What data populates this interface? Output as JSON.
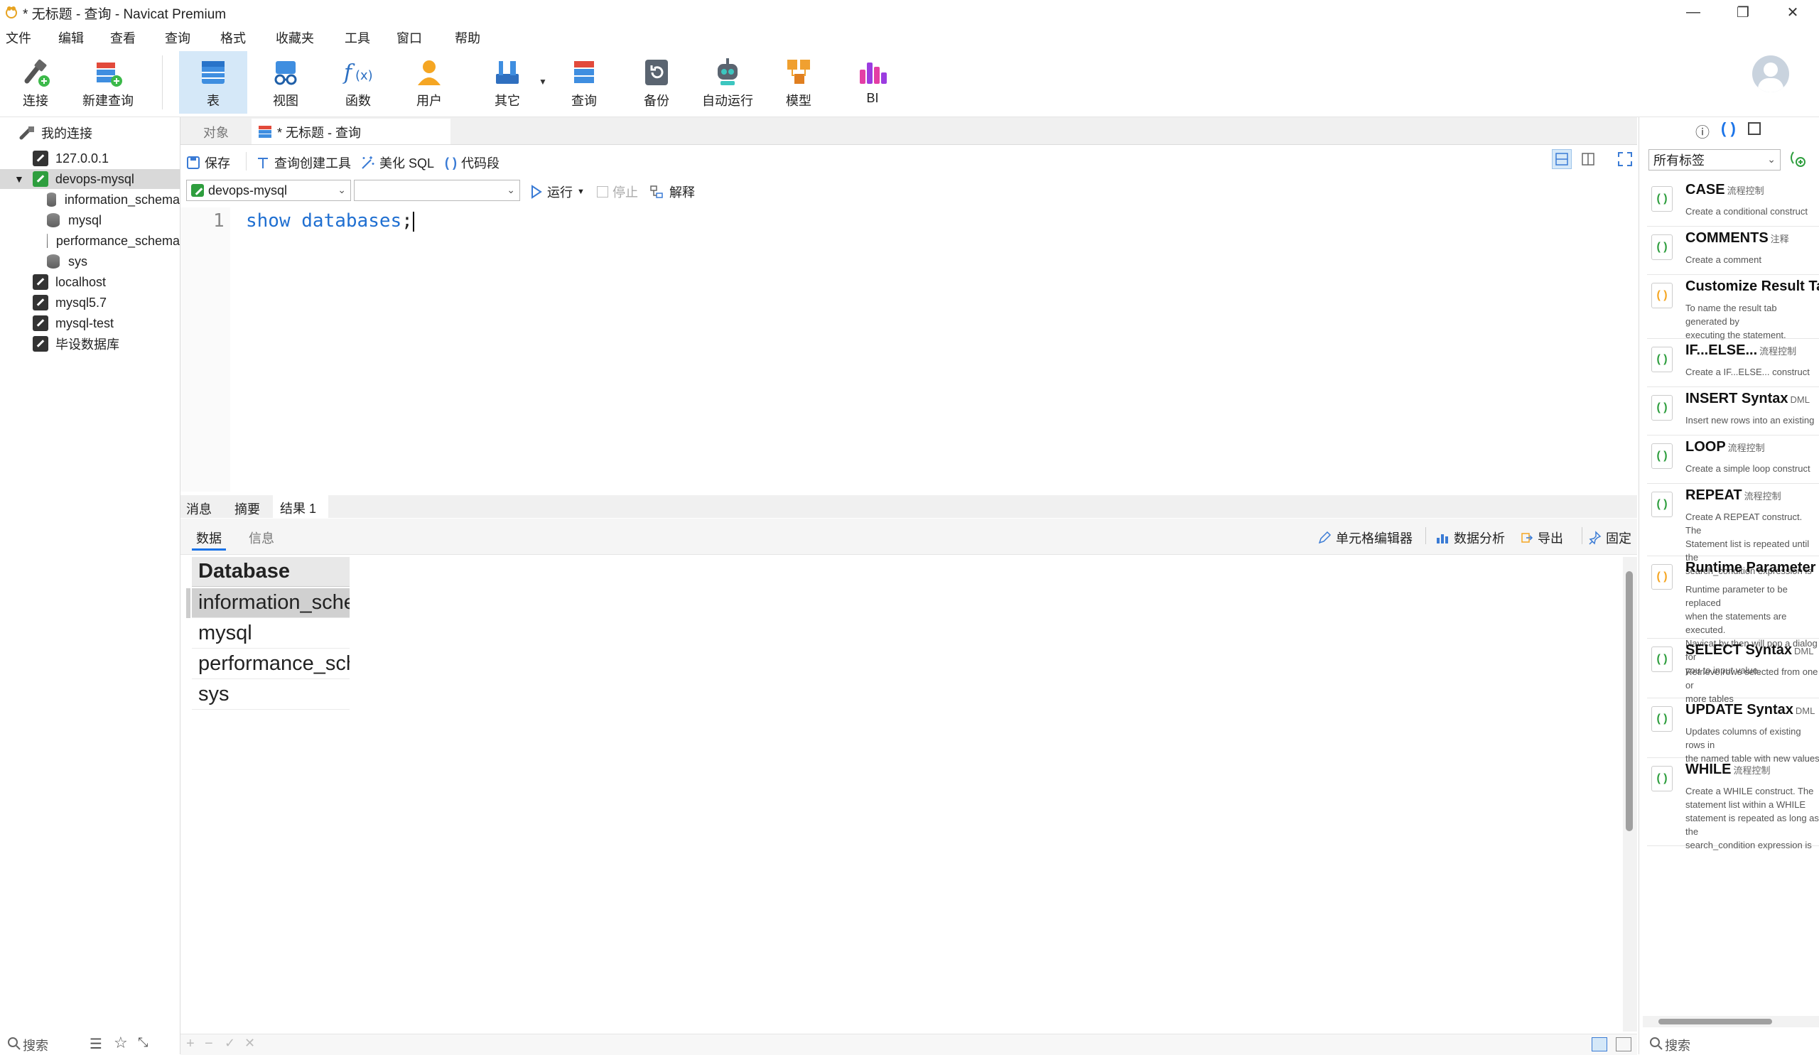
{
  "window": {
    "title": "* 无标题 - 查询 - Navicat Premium"
  },
  "menu": [
    "文件",
    "编辑",
    "查看",
    "查询",
    "格式",
    "收藏夹",
    "工具",
    "窗口",
    "帮助"
  ],
  "toolbar": {
    "items": [
      {
        "label": "连接"
      },
      {
        "label": "新建查询"
      },
      {
        "label": "表"
      },
      {
        "label": "视图"
      },
      {
        "label": "函数"
      },
      {
        "label": "用户"
      },
      {
        "label": "其它"
      },
      {
        "label": "查询"
      },
      {
        "label": "备份"
      },
      {
        "label": "自动运行"
      },
      {
        "label": "模型"
      },
      {
        "label": "BI"
      }
    ]
  },
  "tree": {
    "root": "我的连接",
    "items": [
      {
        "label": "127.0.0.1"
      },
      {
        "label": "devops-mysql"
      },
      {
        "label": "information_schema"
      },
      {
        "label": "mysql"
      },
      {
        "label": "performance_schema"
      },
      {
        "label": "sys"
      },
      {
        "label": "localhost"
      },
      {
        "label": "mysql5.7"
      },
      {
        "label": "mysql-test"
      },
      {
        "label": "毕设数据库"
      }
    ],
    "search_placeholder": "搜索"
  },
  "tabs": {
    "objects": "对象",
    "query": "* 无标题 - 查询"
  },
  "editor_toolbar": {
    "save": "保存",
    "builder": "查询创建工具",
    "beautify": "美化 SQL",
    "snippet": "代码段",
    "connection": "devops-mysql",
    "database": "",
    "run": "运行",
    "stop": "停止",
    "explain": "解释"
  },
  "editor": {
    "line_no": "1",
    "kw1": "show",
    "kw2": "databases",
    "semi": ";"
  },
  "result_tabs": {
    "message": "消息",
    "summary": "摘要",
    "result1": "结果 1"
  },
  "sub_tabs": {
    "data": "数据",
    "info": "信息"
  },
  "result_actions": {
    "cell_editor": "单元格编辑器",
    "analysis": "数据分析",
    "export": "导出",
    "pin": "固定"
  },
  "grid": {
    "header": "Database",
    "rows": [
      "information_schema",
      "mysql",
      "performance_schema",
      "sys"
    ]
  },
  "right_panel": {
    "tag_select": "所有标签",
    "search_placeholder": "搜索",
    "snippets": [
      {
        "title": "CASE",
        "tag": "流程控制",
        "desc": "Create a conditional construct"
      },
      {
        "title": "COMMENTS",
        "tag": "注释",
        "desc": "Create a comment"
      },
      {
        "title": "Customize Result Tab",
        "tag": "",
        "desc": "To name the result tab generated by\nexecuting the statement."
      },
      {
        "title": "IF...ELSE...",
        "tag": "流程控制",
        "desc": "Create a IF...ELSE... construct"
      },
      {
        "title": "INSERT Syntax",
        "tag": "DML",
        "desc": "Insert new rows into an existing"
      },
      {
        "title": "LOOP",
        "tag": "流程控制",
        "desc": "Create a simple loop construct"
      },
      {
        "title": "REPEAT",
        "tag": "流程控制",
        "desc": "Create A REPEAT construct. The\nStatement list is repeated until the\nsearch_condition expression is"
      },
      {
        "title": "Runtime Parameter",
        "tag": "",
        "desc": "Runtime parameter to be replaced\nwhen the statements are executed.\nNavicat by then will pop a dialog for\nyou to input value."
      },
      {
        "title": "SELECT Syntax",
        "tag": "DML",
        "desc": "Retrieve rows selected from one or\nmore tables"
      },
      {
        "title": "UPDATE Syntax",
        "tag": "DML",
        "desc": "Updates columns of existing rows in\nthe named table with new values"
      },
      {
        "title": "WHILE",
        "tag": "流程控制",
        "desc": "Create a WHILE construct. The\nstatement list within a WHILE\nstatement is repeated as long as the\nsearch_condition expression is"
      }
    ]
  },
  "colors": {
    "accent": "#1a73e8",
    "keyword": "#1565c0",
    "selected_tab": "#d5e8f8",
    "snippet_green": "#2e9e3e"
  }
}
